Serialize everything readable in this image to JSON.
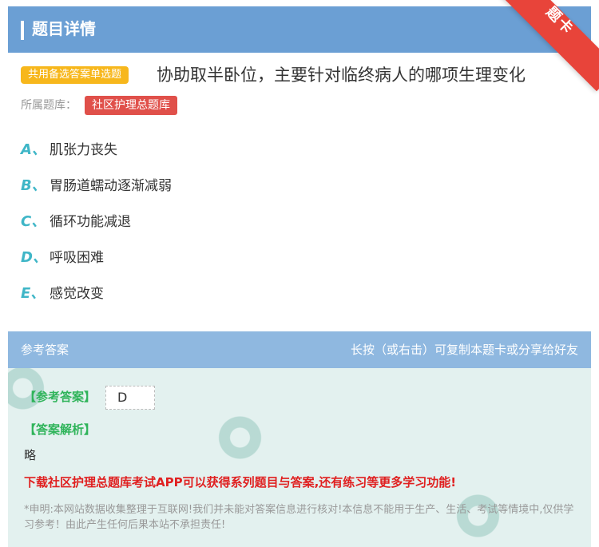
{
  "header": {
    "title": "题目详情",
    "corner_tag": "题卡"
  },
  "question": {
    "type_badge": "共用备选答案单选题",
    "text": "协助取半卧位，主要针对临终病人的哪项生理变化",
    "library_label": "所属题库：",
    "library_name": "社区护理总题库"
  },
  "options": [
    {
      "letter": "A、",
      "text": "肌张力丧失"
    },
    {
      "letter": "B、",
      "text": "胃肠道蠕动逐渐减弱"
    },
    {
      "letter": "C、",
      "text": "循环功能减退"
    },
    {
      "letter": "D、",
      "text": "呼吸困难"
    },
    {
      "letter": "E、",
      "text": "感觉改变"
    }
  ],
  "reference": {
    "title": "参考答案",
    "hint": "长按（或右击）可复制本题卡或分享给好友"
  },
  "answer": {
    "label": "【参考答案】",
    "value": "D",
    "analysis_label": "【答案解析】",
    "analysis_text": "略",
    "promo": "下载社区护理总题库考试APP可以获得系列题目与答案,还有练习等更多学习功能!",
    "disclaimer": "*申明:本网站数据收集整理于互联网!我们并未能对答案信息进行核对!本信息不能用于生产、生活、考试等情境中,仅供学习参考！由此产生任何后果本站不承担责任!"
  },
  "colors": {
    "header_bg": "#6b9fd4",
    "option_letter": "#3fb6c7",
    "badge_yellow": "#f7b71c",
    "badge_red": "#e0504a",
    "answer_green": "#2fb45a",
    "promo_red": "#e02020"
  }
}
